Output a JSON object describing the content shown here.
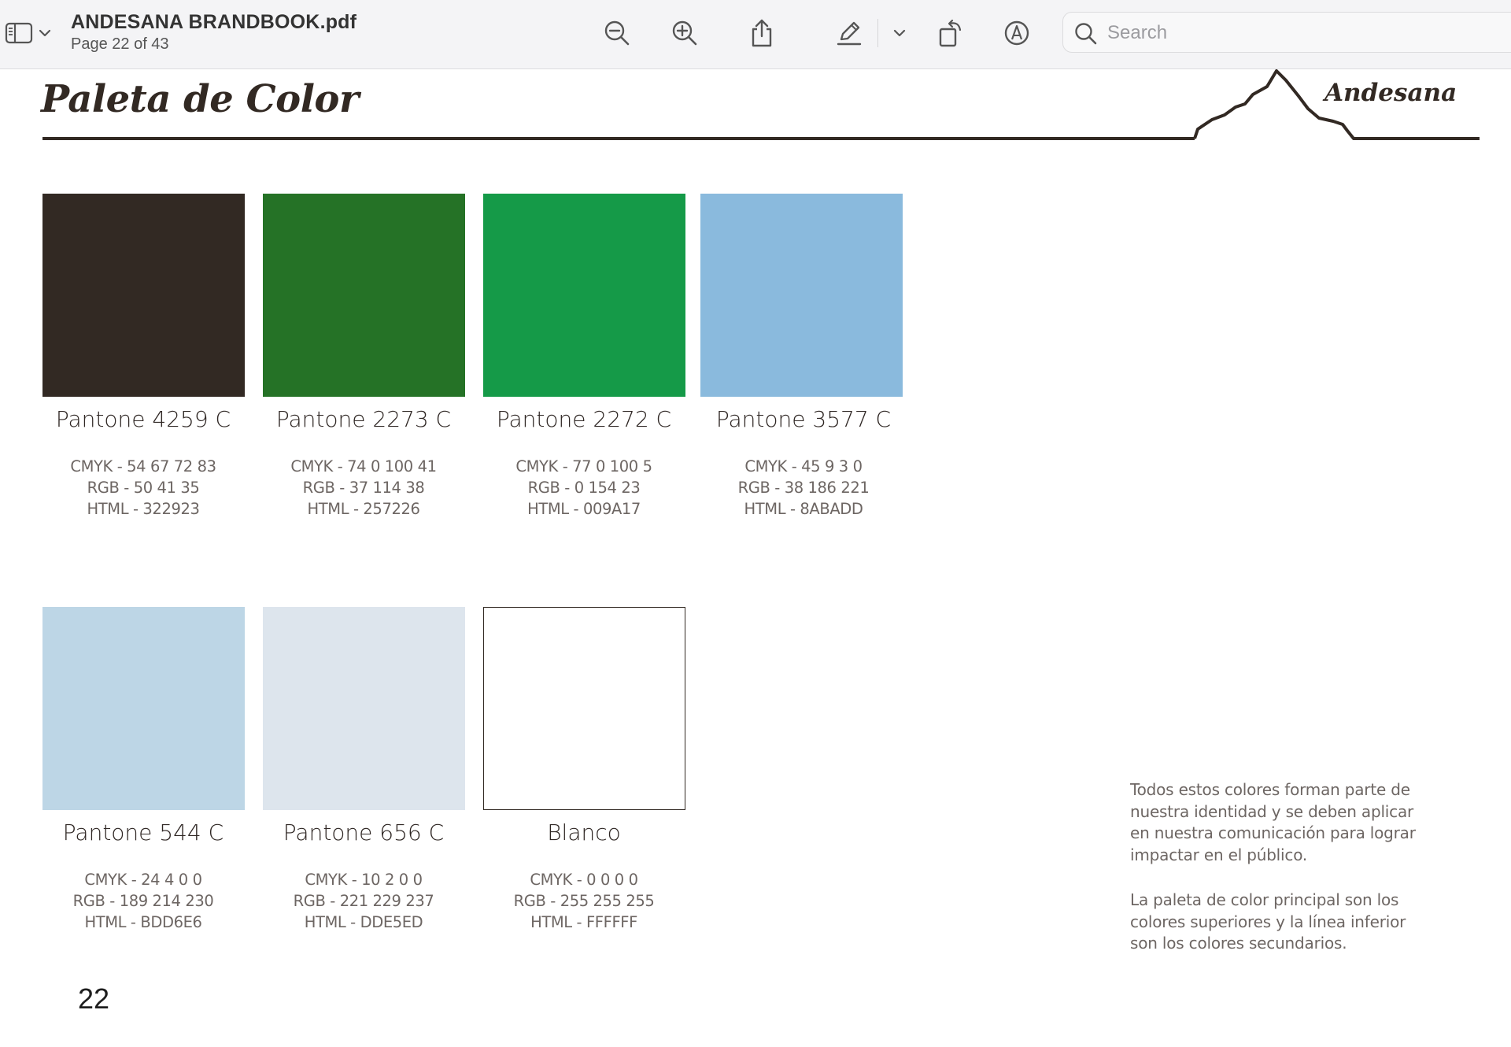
{
  "toolbar": {
    "document_title": "ANDESANA BRANDBOOK.pdf",
    "page_indicator": "Page 22 of 43",
    "search_placeholder": "Search",
    "icons": [
      "sidebar-toggle-icon",
      "chevron-down-icon",
      "zoom-out-icon",
      "zoom-in-icon",
      "share-icon",
      "highlight-pen-icon",
      "chevron-down-icon",
      "rotate-icon",
      "markup-icon",
      "search-icon"
    ]
  },
  "page": {
    "title": "Paleta de Color",
    "brand": "Andesana",
    "number": "22",
    "colors": [
      {
        "name": "Pantone 4259 C",
        "cmyk": "CMYK - 54 67 72 83",
        "rgb": "RGB - 50 41 35",
        "html": "HTML - 322923",
        "hex": "#322923"
      },
      {
        "name": "Pantone 2273 C",
        "cmyk": "CMYK - 74 0 100 41",
        "rgb": "RGB - 37 114 38",
        "html": "HTML - 257226",
        "hex": "#257226"
      },
      {
        "name": "Pantone 2272 C",
        "cmyk": "CMYK - 77 0 100 5",
        "rgb": "RGB - 0 154 23",
        "html": "HTML - 009A17",
        "hex": "#159A48"
      },
      {
        "name": "Pantone 3577 C",
        "cmyk": "CMYK - 45 9 3 0",
        "rgb": "RGB - 38 186 221",
        "html": "HTML - 8ABADD",
        "hex": "#8ABADD"
      },
      {
        "name": "Pantone 544 C",
        "cmyk": "CMYK - 24 4 0 0",
        "rgb": "RGB - 189 214 230",
        "html": "HTML - BDD6E6",
        "hex": "#BDD6E6"
      },
      {
        "name": "Pantone 656 C",
        "cmyk": "CMYK - 10 2 0 0",
        "rgb": "RGB - 221 229 237",
        "html": "HTML - DDE5ED",
        "hex": "#DDE5ED"
      },
      {
        "name": "Blanco",
        "cmyk": "CMYK - 0 0 0 0",
        "rgb": "RGB - 255 255 255",
        "html": "HTML - FFFFFF",
        "hex": "#FFFFFF"
      }
    ],
    "notes": [
      [
        "Todos estos colores forman parte de",
        "nuestra identidad y se deben aplicar",
        "en nuestra comunicación para lograr",
        "impactar en el público."
      ],
      [
        "La paleta de color principal son los",
        "colores superiores y la línea inferior",
        "son los colores secundarios."
      ]
    ]
  }
}
